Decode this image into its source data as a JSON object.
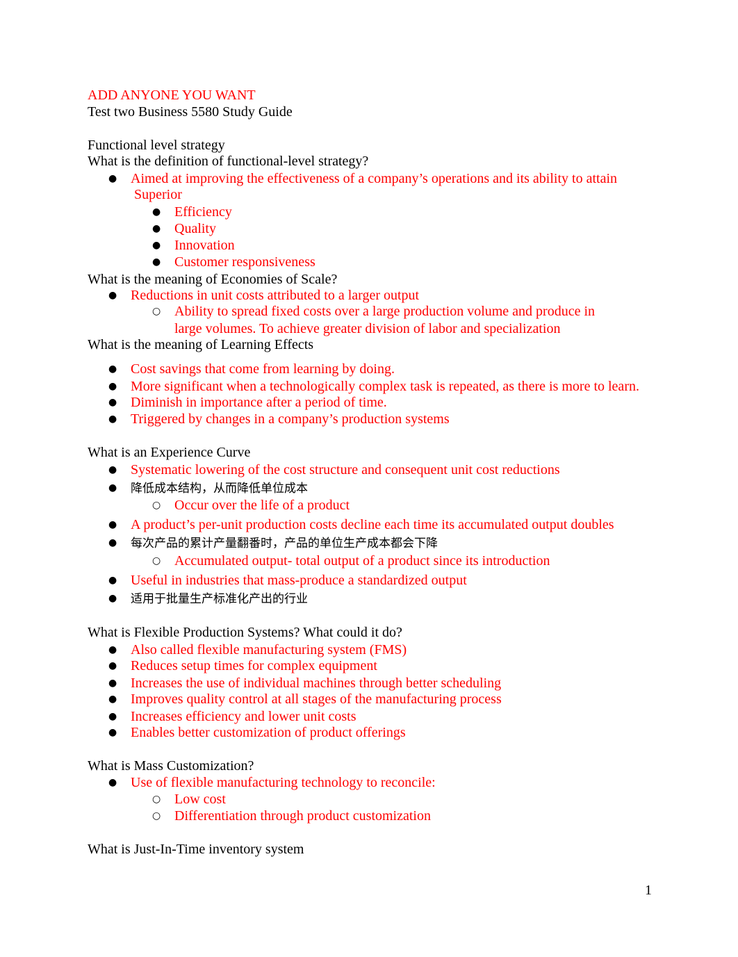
{
  "header": {
    "note": "ADD ANYONE YOU WANT",
    "title": "Test two Business 5580 Study Guide"
  },
  "sections": {
    "functional": {
      "heading": "Functional level strategy",
      "question": "What is the definition of functional-level strategy?",
      "answer_line1": "Aimed at improving the effectiveness of a company’s operations and its ability to attain",
      "answer_line2": "Superior",
      "sub_items": [
        "Efficiency",
        "Quality",
        "Innovation",
        "Customer responsiveness"
      ]
    },
    "economies": {
      "question": "What is the meaning of Economies of Scale?",
      "answer": "Reductions in unit costs attributed to a larger output",
      "sub_line1": "Ability to spread fixed costs over a large production volume and produce in",
      "sub_line2": "large volumes. To achieve greater division of labor and specialization"
    },
    "learning": {
      "question": "What is the meaning of Learning Effects",
      "items": [
        "Cost savings that come from learning by doing.",
        "More significant when a technologically complex task is repeated, as there is more to learn.",
        "Diminish in importance after a period of time.",
        "Triggered by changes in a company’s production systems"
      ]
    },
    "experience": {
      "question": "What is an Experience Curve",
      "item1": "Systematic lowering of the cost structure and consequent unit cost reductions",
      "item1_cn": "降低成本结构，从而降低单位成本",
      "item1_sub": "Occur over the life of a product",
      "item2": "A product’s per-unit production costs decline each time its accumulated output doubles",
      "item2_cn": "每次产品的累计产量翻番时，产品的单位生产成本都会下降",
      "item2_sub": "Accumulated output- total output of a product since its introduction",
      "item3": "Useful in industries that mass-produce a standardized output",
      "item3_cn": "适用于批量生产标准化产出的行业"
    },
    "flexible": {
      "question": "What is Flexible Production Systems? What could it do?",
      "items": [
        "Also called flexible manufacturing system (FMS)",
        "Reduces setup times for complex equipment",
        "Increases the use of individual machines through better scheduling",
        "Improves quality control at all stages of the manufacturing process",
        "Increases efficiency and lower unit costs",
        "Enables better customization of product offerings"
      ]
    },
    "mass": {
      "question": "What is Mass Customization?",
      "answer": "Use of flexible manufacturing technology to reconcile:",
      "sub_items": [
        "Low cost",
        "Differentiation through product customization"
      ]
    },
    "jit": {
      "question": "What is Just-In-Time inventory system"
    }
  },
  "bullets": {
    "filled": "●",
    "hollow": "○"
  },
  "footer": {
    "page_number": "1"
  }
}
